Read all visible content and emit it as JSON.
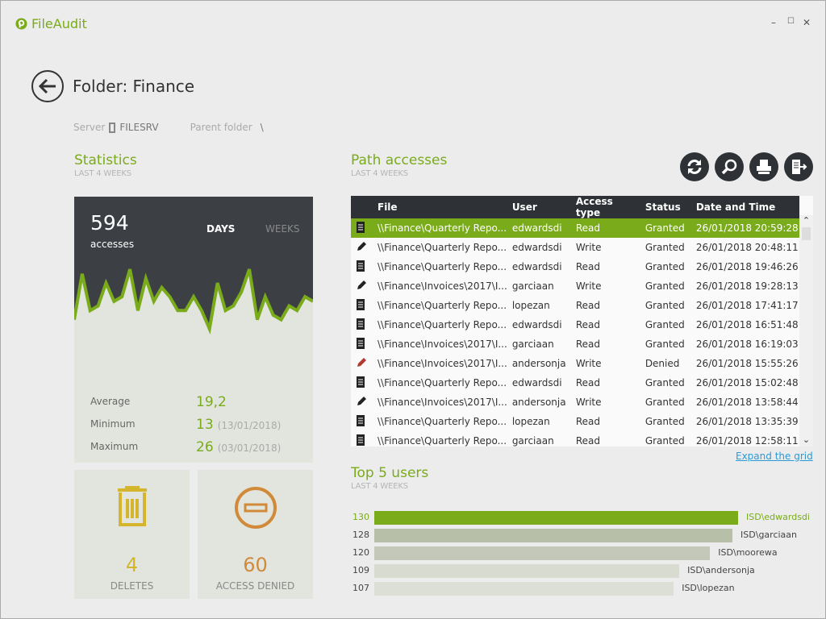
{
  "app": {
    "title": "FileAudit",
    "brand_color": "#7aab1b"
  },
  "window": {
    "minimize": "–",
    "maximize": "☐",
    "close": "✕"
  },
  "header": {
    "title": "Folder: Finance",
    "server_label": "Server",
    "server_value": "FILESRV",
    "parent_label": "Parent folder",
    "parent_value": "\\"
  },
  "statistics": {
    "title": "Statistics",
    "subtitle": "LAST 4 WEEKS",
    "total": "594",
    "total_label": "accesses",
    "tab_days": "DAYS",
    "tab_weeks": "WEEKS",
    "average_label": "Average",
    "average": "19,2",
    "minimum_label": "Minimum",
    "minimum": "13",
    "minimum_date": "(13/01/2018)",
    "maximum_label": "Maximum",
    "maximum": "26",
    "maximum_date": "(03/01/2018)",
    "deletes": "4",
    "deletes_label": "DELETES",
    "denied": "60",
    "denied_label": "ACCESS DENIED"
  },
  "chart_data": {
    "type": "area",
    "values": [
      15,
      25,
      17,
      18,
      23,
      19,
      20,
      26,
      17,
      24,
      19,
      22,
      20,
      17,
      17,
      20,
      17,
      13,
      23,
      17,
      18,
      21,
      26,
      15,
      20,
      16,
      15,
      18,
      17,
      20,
      19
    ],
    "ylim": [
      13,
      26
    ],
    "grid": false
  },
  "path_accesses": {
    "title": "Path accesses",
    "subtitle": "LAST 4 WEEKS",
    "toolbar": [
      "refresh-icon",
      "search-icon",
      "print-icon",
      "export-icon"
    ],
    "columns": [
      "File",
      "User",
      "Access type",
      "Status",
      "Date and Time"
    ],
    "rows": [
      {
        "icon": "read",
        "file": "\\\\Finance\\Quarterly Repo...",
        "user": "edwardsdi",
        "type": "Read",
        "status": "Granted",
        "date": "26/01/2018 20:59:28"
      },
      {
        "icon": "write",
        "file": "\\\\Finance\\Quarterly Repo...",
        "user": "edwardsdi",
        "type": "Write",
        "status": "Granted",
        "date": "26/01/2018 20:48:11"
      },
      {
        "icon": "read",
        "file": "\\\\Finance\\Quarterly Repo...",
        "user": "edwardsdi",
        "type": "Read",
        "status": "Granted",
        "date": "26/01/2018 19:46:26"
      },
      {
        "icon": "write",
        "file": "\\\\Finance\\Invoices\\2017\\I...",
        "user": "garciaan",
        "type": "Write",
        "status": "Granted",
        "date": "26/01/2018 19:28:13"
      },
      {
        "icon": "read",
        "file": "\\\\Finance\\Quarterly Repo...",
        "user": "lopezan",
        "type": "Read",
        "status": "Granted",
        "date": "26/01/2018 17:41:17"
      },
      {
        "icon": "read",
        "file": "\\\\Finance\\Quarterly Repo...",
        "user": "edwardsdi",
        "type": "Read",
        "status": "Granted",
        "date": "26/01/2018 16:51:48"
      },
      {
        "icon": "read",
        "file": "\\\\Finance\\Invoices\\2017\\I...",
        "user": "garciaan",
        "type": "Read",
        "status": "Granted",
        "date": "26/01/2018 16:19:03"
      },
      {
        "icon": "write-denied",
        "file": "\\\\Finance\\Invoices\\2017\\I...",
        "user": "andersonja",
        "type": "Write",
        "status": "Denied",
        "date": "26/01/2018 15:55:26"
      },
      {
        "icon": "read",
        "file": "\\\\Finance\\Quarterly Repo...",
        "user": "edwardsdi",
        "type": "Read",
        "status": "Granted",
        "date": "26/01/2018 15:02:48"
      },
      {
        "icon": "write",
        "file": "\\\\Finance\\Invoices\\2017\\I...",
        "user": "andersonja",
        "type": "Write",
        "status": "Granted",
        "date": "26/01/2018 13:58:44"
      },
      {
        "icon": "read",
        "file": "\\\\Finance\\Quarterly Repo...",
        "user": "lopezan",
        "type": "Read",
        "status": "Granted",
        "date": "26/01/2018 13:35:39"
      },
      {
        "icon": "read",
        "file": "\\\\Finance\\Quarterly Repo...",
        "user": "garciaan",
        "type": "Read",
        "status": "Granted",
        "date": "26/01/2018 12:58:11"
      }
    ],
    "expand_link": "Expand the grid"
  },
  "top_users": {
    "title": "Top 5 users",
    "subtitle": "LAST 4 WEEKS",
    "users": [
      {
        "value": 130,
        "label": "ISD\\edwardsdi"
      },
      {
        "value": 128,
        "label": "ISD\\garciaan"
      },
      {
        "value": 120,
        "label": "ISD\\moorewa"
      },
      {
        "value": 109,
        "label": "ISD\\andersonja"
      },
      {
        "value": 107,
        "label": "ISD\\lopezan"
      }
    ]
  }
}
